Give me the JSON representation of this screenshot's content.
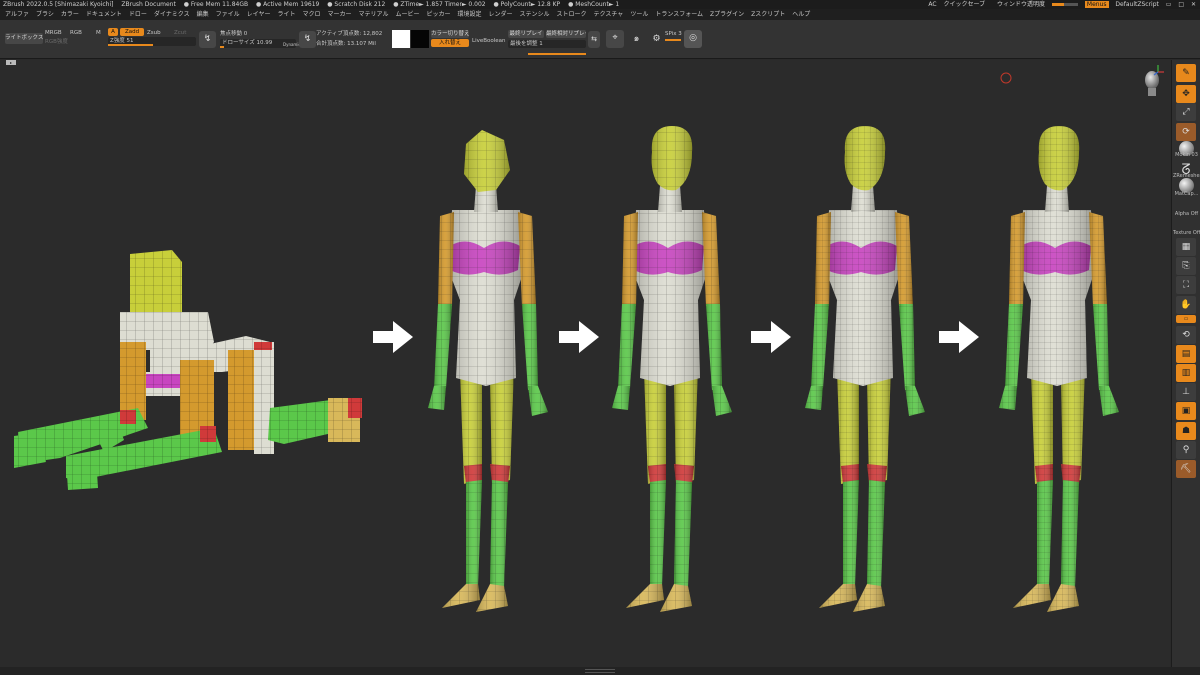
{
  "titlebar": {
    "app": "ZBrush 2022.0.5 [Shimazaki Kyoichi]",
    "document": "ZBrush Document",
    "free_mem": "● Free Mem 11.84GB",
    "active_mem": "● Active Mem 19619",
    "scratch": "● Scratch Disk 212",
    "ztime": "● ZTime► 1.857 Timer► 0.002",
    "polycount": "● PolyCount► 12.8 KP",
    "meshcount": "● MeshCount► 1",
    "ac": "AC",
    "quicksave": "クイックセーブ",
    "see_through": "ウィンドウ透明度",
    "see_through_level": 0.45,
    "menus": "Menus",
    "default_zscript": "DefaultZScript"
  },
  "menu": [
    "アルファ",
    "ブラシ",
    "カラー",
    "ドキュメント",
    "ドロー",
    "ダイナミクス",
    "編集",
    "ファイル",
    "レイヤー",
    "ライト",
    "マクロ",
    "マーカー",
    "マテリアル",
    "ムービー",
    "ピッカー",
    "環境設定",
    "レンダー",
    "ステンシル",
    "ストローク",
    "テクスチャ",
    "ツール",
    "トランスフォーム",
    "Zプラグイン",
    "Zスクリプト",
    "ヘルプ"
  ],
  "shelf": {
    "lightbox": "ライトボックス",
    "mrgb": "MRGB",
    "rgb": "RGB",
    "m": "M",
    "a": "A",
    "zadd": "Zadd",
    "zsub": "Zsub",
    "zcut": "Zcut",
    "rgb_intensity": "RGB強度",
    "z_intensity": "Z強度 51",
    "z_intensity_level": 0.51,
    "focal_shift": "焦点移動 0",
    "draw_size": "ドローサイズ 10.99",
    "dynamic": "Dynamic",
    "active_points": "アクティブ頂点数: 12,802",
    "total_points": "合計頂点数: 13.107 Mil",
    "color_switch": "カラー切り替え",
    "swap": "入れ替え",
    "live_boolean": "LiveBoolean",
    "replay_last": "最終リプレイ",
    "replay_last_rel": "最終相対リプレイ",
    "adjust_last": "最後を調整 1",
    "spix": "SPix 3"
  },
  "right_shelf": {
    "sample_label": "Mokin 03",
    "brush_label": "ZRemesher",
    "material_label": "MatCap...",
    "alpha_label": "Alpha Off",
    "texture_label": "Texture Off"
  },
  "colors": {
    "accent": "#e8891c",
    "head": "#c8cf3a",
    "torso": "#ddddd2",
    "chest": "#c845c0",
    "arm": "#5bc84a",
    "upper_arm": "#d49a2e",
    "thigh": "#c8cf3a",
    "knee": "#d03a3a",
    "foot": "#d8b85a"
  }
}
